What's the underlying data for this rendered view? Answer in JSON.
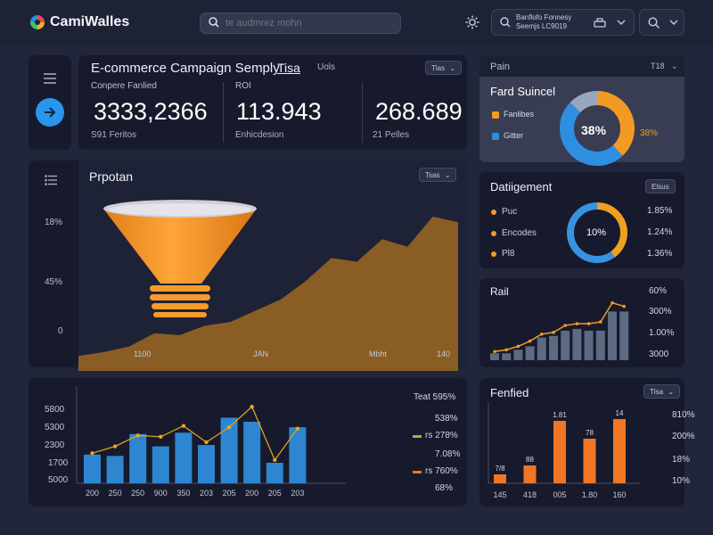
{
  "header": {
    "brand": "CamiWalles",
    "search_placeholder": "te audmrez mohn",
    "account_line1": "Banflofo Fonnesy",
    "account_line2": "Seemjs LC9019"
  },
  "campaign": {
    "title": "E-commerce Campaign Semply",
    "title_link": "Tisa",
    "tab": "Uols",
    "dropdown": "Tlas",
    "metrics": [
      {
        "label": "Conpere Fanlied",
        "value": "3333,2366",
        "sub": "S91 Feritos"
      },
      {
        "label": "ROI",
        "value": "113.943",
        "sub": "Enhicdesion"
      },
      {
        "label": "",
        "value": "268.689",
        "sub": "21 Pelles"
      }
    ]
  },
  "funnel": {
    "title": "Prpotan",
    "dropdown": "Tsas",
    "y_labels": [
      "18%",
      "45%",
      "0"
    ],
    "x_labels": [
      "1100",
      "JAN",
      "Mbht",
      "140"
    ]
  },
  "pie_card": {
    "header": "Pain",
    "dropdown": "T18",
    "title": "Fard Suincel",
    "legend": [
      "Fanlibes",
      "Gitter"
    ],
    "center": "38%",
    "side": "38%"
  },
  "donut_card": {
    "title": "Datiigement",
    "chip": "Elsus",
    "items": [
      {
        "label": "Puc",
        "value": "1.85%"
      },
      {
        "label": "Encodes",
        "value": "1.24%"
      },
      {
        "label": "Pl8",
        "value": "1.36%"
      }
    ],
    "center": "10%"
  },
  "rail": {
    "title": "Rail",
    "axis": [
      "60%",
      "300%",
      "1.00%",
      "3000"
    ]
  },
  "combo": {
    "y_labels": [
      "5800",
      "5300",
      "2300",
      "1700",
      "5000"
    ],
    "x_labels": [
      "200",
      "250",
      "250",
      "900",
      "350",
      "203",
      "205",
      "200",
      "205",
      "203"
    ],
    "legend": [
      {
        "label": "Teat 595%"
      },
      {
        "label": "538%"
      },
      {
        "label": "rs 278%"
      },
      {
        "label": "7.08%"
      },
      {
        "label": "rs 760%"
      },
      {
        "label": "68%"
      }
    ]
  },
  "fenfied": {
    "title": "Fenfied",
    "chip": "Tlsa",
    "top_labels": [
      "7/8",
      "88",
      "1.81",
      "78",
      "14"
    ],
    "x_labels": [
      "145",
      "418",
      "005",
      "1.80",
      "160"
    ],
    "axis": [
      "810%",
      "200%",
      "18%",
      "10%"
    ]
  },
  "chart_data": [
    {
      "type": "area",
      "title": "Prpotan",
      "x_ticks": [
        "1100",
        "JAN",
        "Mbht",
        "140"
      ],
      "y_ticks": [
        "18%",
        "45%",
        "0"
      ],
      "values": [
        8,
        10,
        13,
        20,
        19,
        24,
        26,
        32,
        38,
        48,
        60,
        58,
        70,
        66,
        82,
        79
      ]
    },
    {
      "type": "pie",
      "title": "Fard Suincel",
      "slices": [
        {
          "name": "Fanlibes",
          "value": 38,
          "color": "#f39a25"
        },
        {
          "name": "Gitter",
          "value": 49,
          "color": "#2e8fe0"
        },
        {
          "name": "",
          "value": 13,
          "color": "#9aa6bd"
        }
      ]
    },
    {
      "type": "pie",
      "title": "Datiigement",
      "slices": [
        {
          "name": "Puc",
          "value": 40,
          "color": "#f0a020"
        },
        {
          "name": "Encodes",
          "value": 60,
          "color": "#3793e0"
        }
      ]
    },
    {
      "type": "bar",
      "title": "Rail",
      "values": [
        4,
        4,
        6,
        8,
        13,
        14,
        17,
        18,
        17,
        17,
        28,
        28
      ],
      "line": [
        5,
        6,
        8,
        11,
        15,
        16,
        20,
        21,
        21,
        22,
        33,
        31
      ],
      "ylim": [
        0,
        40
      ]
    },
    {
      "type": "bar",
      "title": "",
      "categories": [
        "200",
        "250",
        "250",
        "900",
        "350",
        "203",
        "205",
        "200",
        "205",
        "203"
      ],
      "values": [
        2100,
        2000,
        3600,
        2700,
        3700,
        2800,
        4800,
        4500,
        1500,
        4100
      ],
      "line": [
        2200,
        2700,
        3500,
        3400,
        4200,
        3000,
        4100,
        5600,
        1700,
        4000
      ],
      "y_ticks": [
        "5800",
        "5300",
        "2300",
        "1700",
        "5000"
      ]
    },
    {
      "type": "bar",
      "title": "Fenfied",
      "categories": [
        "145",
        "418",
        "005",
        "1.80",
        "160"
      ],
      "values": [
        1,
        2,
        7,
        5,
        7.2
      ],
      "data_labels": [
        "7/8",
        "88",
        "1.81",
        "78",
        "14"
      ]
    }
  ],
  "colors": {
    "orange": "#f39a25",
    "blue": "#2e8fe0",
    "bronze": "#8a5d25",
    "red_orange": "#f07524",
    "steel": "#5c6a82"
  }
}
